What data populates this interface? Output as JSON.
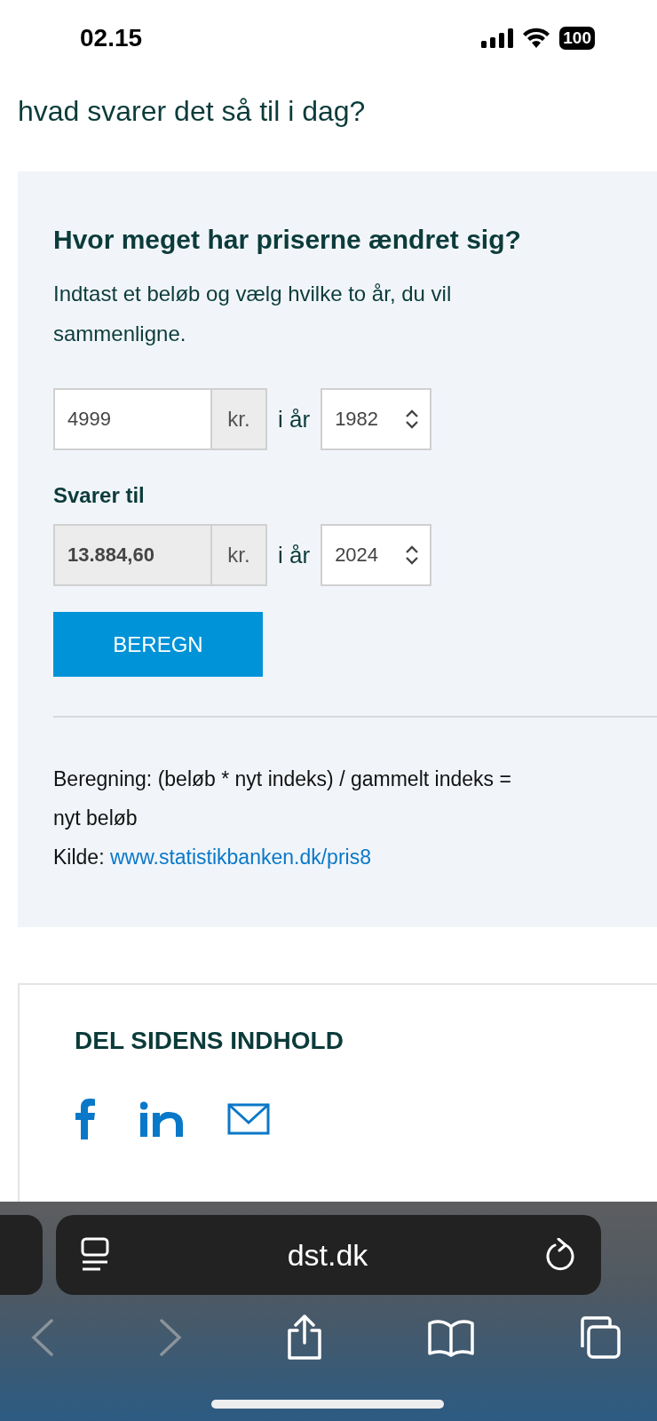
{
  "status_bar": {
    "time": "02.15",
    "battery": "100"
  },
  "intro": {
    "text": "hvad svarer det så til i dag?"
  },
  "calculator": {
    "title": "Hvor meget har priserne ændret sig?",
    "description": "Indtast et beløb og vælg hvilke to år, du vil sammenligne.",
    "rows": [
      {
        "kind": "input",
        "amount": "4999",
        "unit": "kr.",
        "year_label": "i år",
        "year": "1982"
      },
      {
        "kind": "result",
        "label": "Svarer til",
        "amount": "13.884,60",
        "unit": "kr.",
        "year_label": "i år",
        "year": "2024"
      }
    ],
    "button": "BEREGN",
    "formula": "Beregning: (beløb * nyt indeks) / gammelt indeks =\nnyt beløb",
    "source_label": "Kilde:",
    "source_link": "www.statistikbanken.dk/pris8"
  },
  "share": {
    "title": "DEL SIDENS INDHOLD"
  },
  "browser": {
    "url": "dst.dk",
    "nav": [
      {
        "kind": "back",
        "disabled": true
      },
      {
        "kind": "forward",
        "disabled": true
      },
      {
        "kind": "share",
        "disabled": false
      },
      {
        "kind": "bookmarks",
        "disabled": false
      },
      {
        "kind": "tabs",
        "disabled": false
      }
    ]
  }
}
